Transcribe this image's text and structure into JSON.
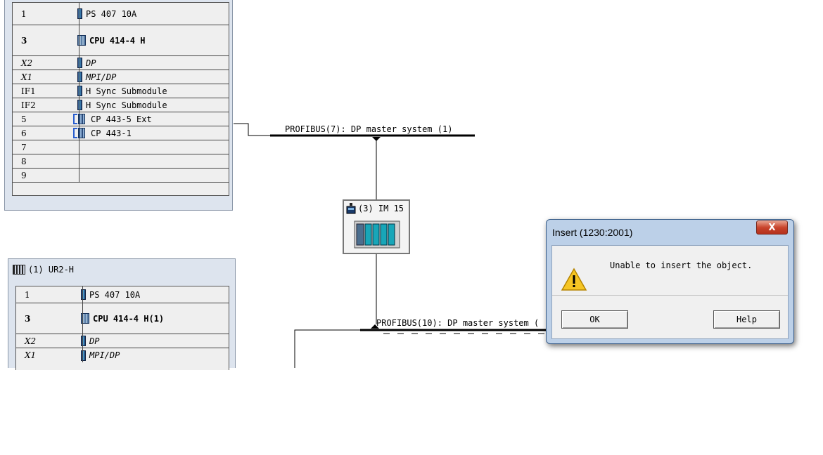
{
  "rack1": {
    "rows": [
      {
        "slot": "1",
        "module": "PS 407 10A",
        "icon": "ps-module-icon"
      },
      {
        "slot": "3",
        "module": "CPU 414-4 H",
        "icon": "cpu-module-icon"
      },
      {
        "slot": "X2",
        "module": "DP",
        "icon": "dp-module-icon"
      },
      {
        "slot": "X1",
        "module": "MPI/DP",
        "icon": "mpi-module-icon"
      },
      {
        "slot": "IF1",
        "module": "H Sync Submodule",
        "icon": "sync-module-icon"
      },
      {
        "slot": "IF2",
        "module": "H Sync Submodule",
        "icon": "sync-module-icon"
      },
      {
        "slot": "5",
        "module": "CP 443-5 Ext",
        "icon": "cp-module-icon"
      },
      {
        "slot": "6",
        "module": "CP 443-1",
        "icon": "cp-module-icon"
      },
      {
        "slot": "7",
        "module": ""
      },
      {
        "slot": "8",
        "module": ""
      },
      {
        "slot": "9",
        "module": ""
      }
    ]
  },
  "rack2": {
    "title": "(1) UR2-H",
    "rows": [
      {
        "slot": "1",
        "module": "PS 407 10A"
      },
      {
        "slot": "3",
        "module": "CPU 414-4 H(1)"
      },
      {
        "slot": "X2",
        "module": "DP"
      },
      {
        "slot": "X1",
        "module": "MPI/DP"
      }
    ]
  },
  "network": {
    "bus1_label": "PROFIBUS(7): DP master system (1)",
    "bus2_label": "PROFIBUS(10): DP master system (",
    "station_label": "(3) IM 15"
  },
  "dialog": {
    "title": "Insert (1230:2001)",
    "close_label": "X",
    "message": "Unable to insert the object.",
    "ok_label": "OK",
    "help_label": "Help",
    "icon": "warning-icon"
  }
}
